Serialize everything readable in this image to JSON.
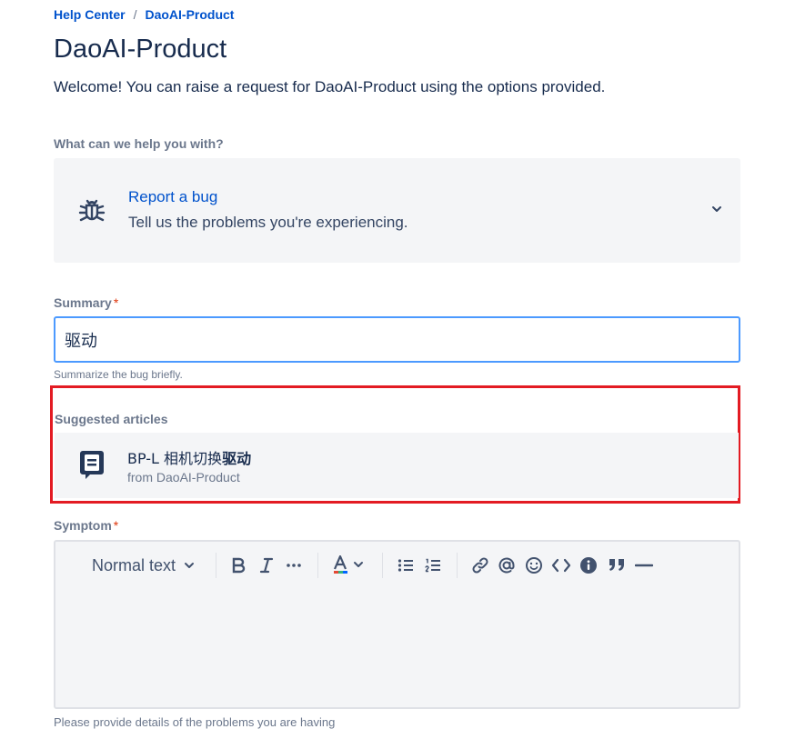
{
  "breadcrumb": {
    "home": "Help Center",
    "separator": "/",
    "current": "DaoAI-Product"
  },
  "page": {
    "title": "DaoAI-Product",
    "welcome": "Welcome! You can raise a request for DaoAI-Product using the options provided."
  },
  "request_type": {
    "section_label": "What can we help you with?",
    "title": "Report a bug",
    "description": "Tell us the problems you're experiencing.",
    "icon": "bug-icon"
  },
  "summary": {
    "label": "Summary",
    "required_mark": "*",
    "value": "驱动",
    "help": "Summarize the bug briefly."
  },
  "suggested": {
    "title": "Suggested articles",
    "articles": [
      {
        "title_prefix": "BP-L 相机切换",
        "title_highlight": "驱动",
        "source": "from DaoAI-Product",
        "icon": "knowledge-article-icon"
      }
    ]
  },
  "symptom": {
    "label": "Symptom",
    "required_mark": "*",
    "toolbar": {
      "text_style": "Normal text",
      "buttons": [
        "bold-icon",
        "italic-icon",
        "more-formatting-icon",
        "text-color-icon",
        "bullet-list-icon",
        "numbered-list-icon",
        "link-icon",
        "mention-icon",
        "emoji-icon",
        "code-icon",
        "info-panel-icon",
        "quote-icon",
        "divider-icon"
      ]
    },
    "help": "Please provide details of the problems you are having"
  },
  "colors": {
    "link": "#0052cc",
    "focus": "#4c9aff",
    "required": "#de350b",
    "highlight_box": "#e31b23",
    "card_bg": "#f4f5f7"
  }
}
